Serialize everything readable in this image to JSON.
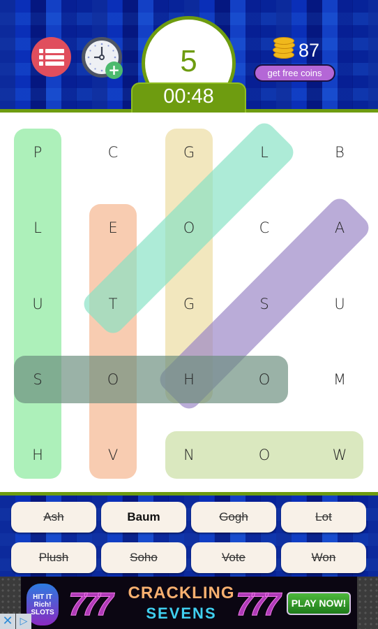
{
  "header": {
    "menu_icon": "list-icon",
    "clock_icon": "clock-add-time-icon",
    "score": "5",
    "timer": "00:48",
    "coins_icon": "coin-stack-icon",
    "coins": "87",
    "free_coins_label": "get free coins"
  },
  "board": {
    "rows": [
      [
        "P",
        "C",
        "G",
        "L",
        "B"
      ],
      [
        "L",
        "E",
        "O",
        "C",
        "A"
      ],
      [
        "U",
        "T",
        "G",
        "S",
        "U"
      ],
      [
        "S",
        "O",
        "H",
        "O",
        "M"
      ],
      [
        "H",
        "V",
        "N",
        "O",
        "W"
      ]
    ],
    "found_highlights": [
      {
        "word": "Plush",
        "color": "#86e99a",
        "from": [
          0,
          0
        ],
        "to": [
          4,
          0
        ]
      },
      {
        "word": "Vote",
        "color": "#f5b48c",
        "from": [
          4,
          1
        ],
        "to": [
          1,
          1
        ]
      },
      {
        "word": "Gogh",
        "color": "#ecdb9f",
        "from": [
          0,
          2
        ],
        "to": [
          3,
          2
        ]
      },
      {
        "word": "Lot",
        "color": "#86e2c4",
        "from": [
          0,
          3
        ],
        "to": [
          2,
          1
        ]
      },
      {
        "word": "Ash",
        "color": "#9a84c6",
        "from": [
          1,
          4
        ],
        "to": [
          3,
          2
        ]
      },
      {
        "word": "Soho",
        "color": "#6a8e7e",
        "from": [
          3,
          0
        ],
        "to": [
          3,
          3
        ]
      },
      {
        "word": "Won",
        "color": "#c8dda0",
        "from": [
          4,
          4
        ],
        "to": [
          4,
          2
        ]
      }
    ]
  },
  "words": [
    {
      "label": "Ash",
      "found": true
    },
    {
      "label": "Baum",
      "found": false
    },
    {
      "label": "Gogh",
      "found": true
    },
    {
      "label": "Lot",
      "found": true
    },
    {
      "label": "Plush",
      "found": true
    },
    {
      "label": "Soho",
      "found": true
    },
    {
      "label": "Vote",
      "found": true
    },
    {
      "label": "Won",
      "found": true
    }
  ],
  "ad": {
    "logo_text": "HIT IT Rich! SLOTS",
    "sevens": "777",
    "title": "CRACKLING",
    "subtitle": "SEVENS",
    "cta": "PLAY NOW!",
    "close_icon": "close-icon",
    "info_icon": "adchoices-icon"
  }
}
